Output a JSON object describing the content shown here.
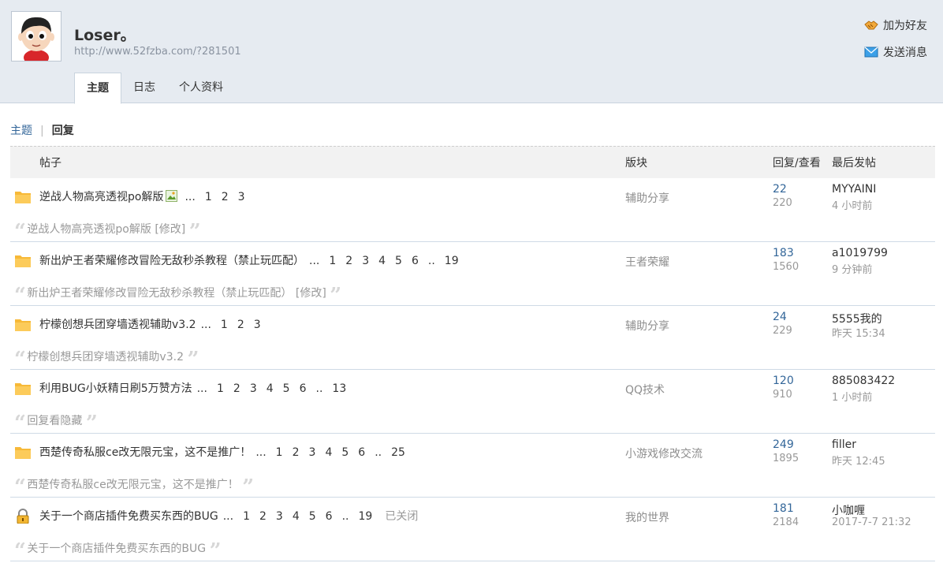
{
  "profile": {
    "username": "Loser。",
    "homepage": "http://www.52fzba.com/?281501",
    "actions": {
      "add_friend": "加为好友",
      "send_message": "发送消息"
    },
    "tabs": [
      "主题",
      "日志",
      "个人资料"
    ]
  },
  "subnav": {
    "threads": "主题",
    "separator": "|",
    "replies": "回复"
  },
  "table": {
    "headers": {
      "post": "帖子",
      "forum": "版块",
      "replies_views": "回复/查看",
      "last_post": "最后发帖"
    },
    "rows": [
      {
        "title": "逆战人物高亮透视po解版",
        "has_image": true,
        "pages": [
          "...",
          "1",
          "2",
          "3"
        ],
        "closed": "",
        "forum": "辅助分享",
        "replies": "22",
        "views": "220",
        "last_user": "MYYAINI",
        "last_time": "4 小时前",
        "quote": "逆战人物高亮透视po解版 [修改]",
        "icon": "folder-icon"
      },
      {
        "title": "新出炉王者荣耀修改冒险无敌秒杀教程（禁止玩匹配）",
        "has_image": false,
        "pages": [
          "...",
          "1",
          "2",
          "3",
          "4",
          "5",
          "6",
          "..",
          "19"
        ],
        "closed": "",
        "forum": "王者荣耀",
        "replies": "183",
        "views": "1560",
        "last_user": "a1019799",
        "last_time": "9 分钟前",
        "quote": "新出炉王者荣耀修改冒险无敌秒杀教程（禁止玩匹配） [修改]",
        "icon": "folder-icon"
      },
      {
        "title": "柠檬创想兵团穿墙透视辅助v3.2",
        "has_image": false,
        "pages": [
          "...",
          "1",
          "2",
          "3"
        ],
        "closed": "",
        "forum": "辅助分享",
        "replies": "24",
        "views": "229",
        "last_user": "5555我的",
        "last_time": "昨天 15:34",
        "quote": "柠檬创想兵团穿墙透视辅助v3.2",
        "icon": "folder-icon"
      },
      {
        "title": "利用BUG小妖精日刷5万赞方法",
        "has_image": false,
        "pages": [
          "...",
          "1",
          "2",
          "3",
          "4",
          "5",
          "6",
          "..",
          "13"
        ],
        "closed": "",
        "forum": "QQ技术",
        "replies": "120",
        "views": "910",
        "last_user": "885083422",
        "last_time": "1 小时前",
        "quote": "回复看隐藏",
        "icon": "folder-icon"
      },
      {
        "title": "西楚传奇私服ce改无限元宝，这不是推广！",
        "has_image": false,
        "pages": [
          "...",
          "1",
          "2",
          "3",
          "4",
          "5",
          "6",
          "..",
          "25"
        ],
        "closed": "",
        "forum": "小游戏修改交流",
        "replies": "249",
        "views": "1895",
        "last_user": "filler",
        "last_time": "昨天 12:45",
        "quote": "西楚传奇私服ce改无限元宝，这不是推广！",
        "icon": "folder-icon"
      },
      {
        "title": "关于一个商店插件免费买东西的BUG",
        "has_image": false,
        "pages": [
          "...",
          "1",
          "2",
          "3",
          "4",
          "5",
          "6",
          "..",
          "19"
        ],
        "closed": "已关闭",
        "forum": "我的世界",
        "replies": "181",
        "views": "2184",
        "last_user": "小咖喱",
        "last_time": "2017-7-7 21:32",
        "quote": "关于一个商店插件免费买东西的BUG",
        "icon": "lock-icon"
      }
    ]
  },
  "colors": {
    "link": "#336699",
    "header_bg": "#e6ebf1",
    "folder": "#f7b938"
  }
}
